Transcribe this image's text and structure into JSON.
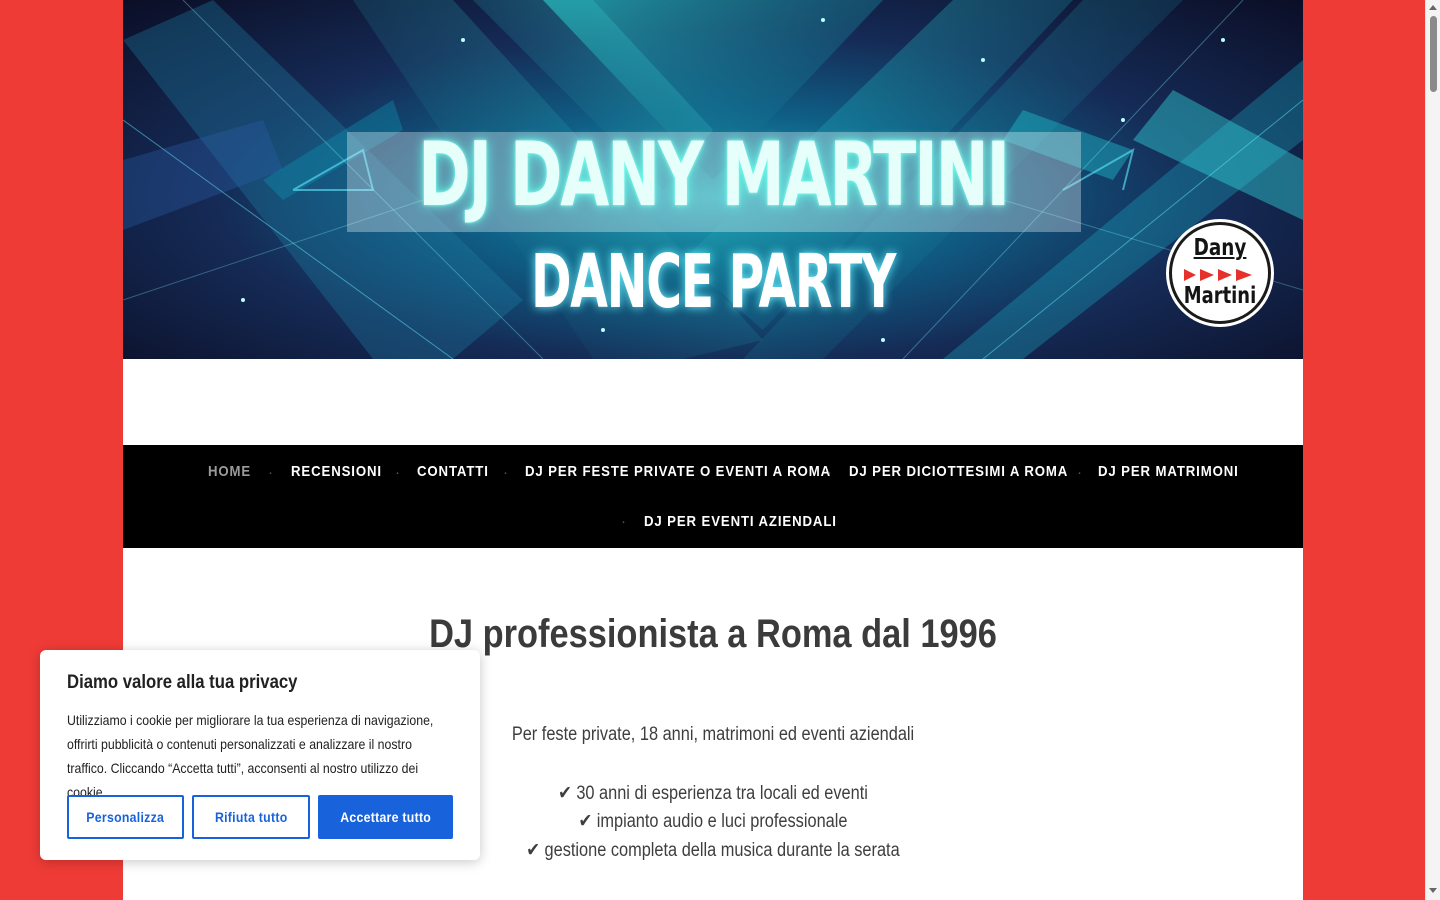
{
  "banner": {
    "title": "DJ DANY MARTINI",
    "subtitle": "DANCE PARTY",
    "logo_top": "Dany",
    "logo_bottom": "Martini"
  },
  "nav": {
    "items": [
      {
        "label": "HOME",
        "active": true
      },
      {
        "label": "RECENSIONI"
      },
      {
        "label": "CONTATTI"
      },
      {
        "label": "DJ PER FESTE PRIVATE O EVENTI A ROMA"
      },
      {
        "label": "DJ PER DICIOTTESIMI A ROMA"
      },
      {
        "label": "DJ PER MATRIMONI"
      },
      {
        "label": "DJ PER EVENTI AZIENDALI"
      }
    ]
  },
  "main": {
    "heading": "DJ professionista a Roma dal 1996",
    "intro": "Per feste private, 18 anni, matrimoni ed eventi aziendali",
    "bullets": [
      "✔ 30 anni di esperienza tra locali ed eventi",
      "✔ impianto audio e luci professionale",
      "✔ gestione completa della musica durante la serata"
    ]
  },
  "cookie": {
    "title": "Diamo valore alla tua privacy",
    "text": "Utilizziamo i cookie per migliorare la tua esperienza di navigazione, offrirti pubblicità o contenuti personalizzati e analizzare il nostro traffico. Cliccando “Accetta tutti”, acconsenti al nostro utilizzo dei cookie.",
    "customize_label": "Personalizza",
    "reject_label": "Rifiuta tutto",
    "accept_label": "Accettare tutto"
  },
  "colors": {
    "page_background": "#ef3b36",
    "nav_background": "#000000",
    "cookie_button": "#1863dc",
    "active_nav": "#9b9b9b"
  }
}
